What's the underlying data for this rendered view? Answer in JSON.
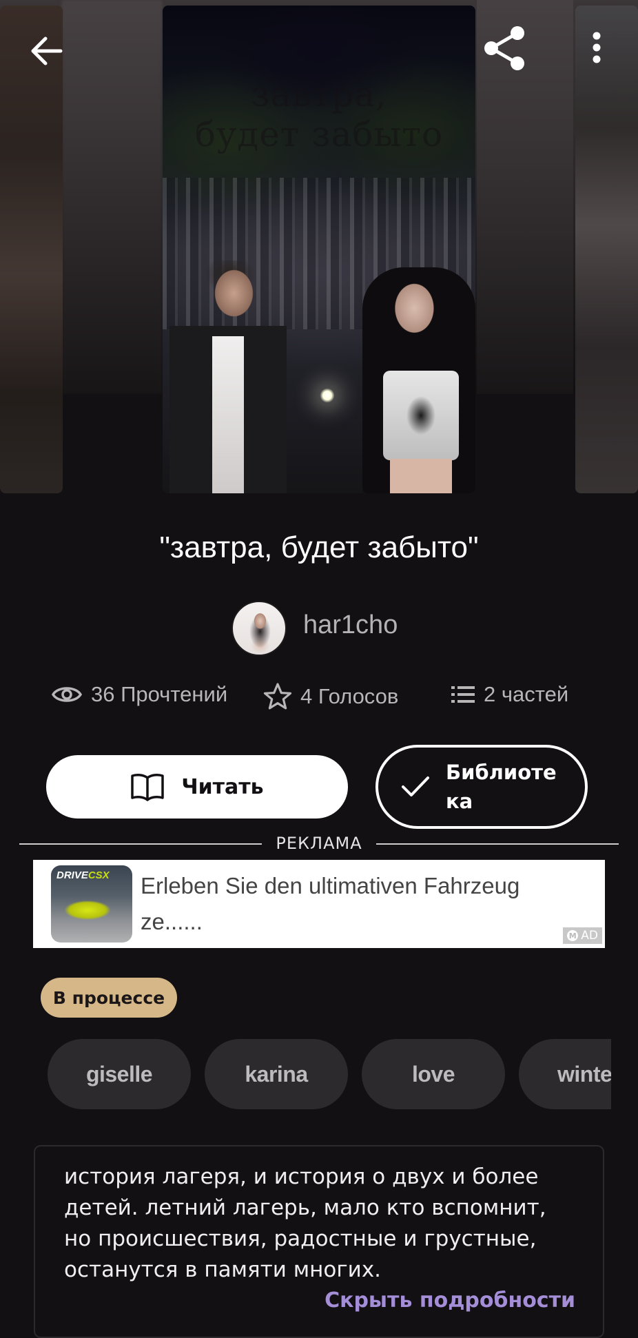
{
  "cover": {
    "title_art": "завтра,\nбудет забыто"
  },
  "story": {
    "title": "\"завтра, будет забыто\"",
    "author": "har1cho"
  },
  "stats": {
    "reads": "36 Прочтений",
    "votes": "4 Голосов",
    "parts": "2 частей"
  },
  "actions": {
    "read_label": "Читать",
    "library_label": "Библиотека"
  },
  "ad": {
    "section_label": "РЕКЛАМА",
    "brand_part1": "DRIVE",
    "brand_part2": "CSX",
    "text": "Erleben Sie den ultimativen Fahrzeug ze......",
    "badge": "AD",
    "badge_logo": "M"
  },
  "status": "В процессе",
  "tags": [
    "giselle",
    "karina",
    "love",
    "winte"
  ],
  "description": {
    "text": "история лагеря, и история о двух и более детей. летний лагерь, мало кто вспомнит, но происшествия, радостные и грустные, останутся в памяти многих.",
    "toggle": "Скрыть подробности"
  },
  "colors": {
    "background": "#121012",
    "status_badge": "#d6b888",
    "accent_link": "#a58ed8",
    "tag_bg": "#2c2a2c"
  },
  "icons": [
    "back-arrow-icon",
    "share-icon",
    "more-vertical-icon",
    "eye-icon",
    "star-icon",
    "list-icon",
    "book-icon",
    "checkmark-icon"
  ]
}
